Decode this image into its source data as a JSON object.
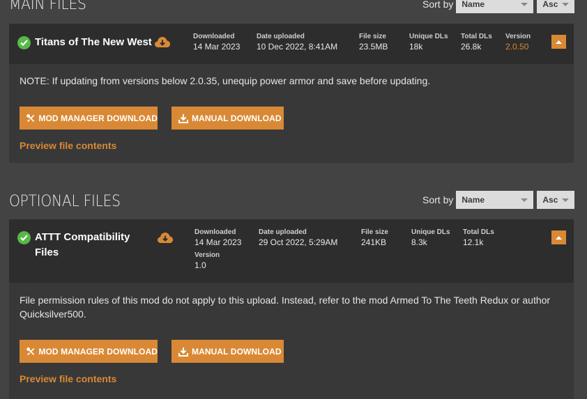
{
  "main_section": {
    "title": "MAIN FILES",
    "sort_label": "Sort by",
    "sort_field": "Name",
    "sort_order": "Asc"
  },
  "main_file": {
    "name": "Titans of The New West",
    "stats": {
      "downloaded_label": "Downloaded",
      "downloaded": "14 Mar 2023",
      "uploaded_label": "Date uploaded",
      "uploaded": "10 Dec 2022, 8:41AM",
      "size_label": "File size",
      "size": "23.5MB",
      "unique_label": "Unique DLs",
      "unique": "18k",
      "total_label": "Total DLs",
      "total": "26.8k",
      "version_label": "Version",
      "version": "2.0.50"
    },
    "description": "NOTE: If updating from versions below 2.0.35, unequip power armor and save before updating.",
    "mod_manager_label": "MOD MANAGER DOWNLOAD",
    "manual_label": "MANUAL DOWNLOAD",
    "preview_label": "Preview file contents"
  },
  "optional_section": {
    "title": "OPTIONAL FILES",
    "sort_label": "Sort by",
    "sort_field": "Name",
    "sort_order": "Asc"
  },
  "optional_file": {
    "name_line1": "ATTT Compatibility",
    "name_line2": "Files",
    "stats": {
      "downloaded_label": "Downloaded",
      "downloaded": "14 Mar 2023",
      "uploaded_label": "Date uploaded",
      "uploaded": "29 Oct 2022, 5:29AM",
      "size_label": "File size",
      "size": "241KB",
      "unique_label": "Unique DLs",
      "unique": "8.3k",
      "total_label": "Total DLs",
      "total": "12.1k",
      "version_label": "Version",
      "version": "1.0"
    },
    "description": "File permission rules of this mod do not apply to this upload. Instead, refer to the mod Armed To The Teeth Redux or author Quicksilver500.",
    "mod_manager_label": "MOD MANAGER DOWNLOAD",
    "manual_label": "MANUAL DOWNLOAD",
    "preview_label": "Preview file contents"
  },
  "colors": {
    "accent": "#d98935",
    "check": "#57b848",
    "background": "#434343",
    "card": "#383838",
    "card_header": "#2d2d2d"
  },
  "icons": [
    "check-circle-icon",
    "cloud-download-icon",
    "mod-manager-icon",
    "download-tray-icon",
    "chevron-up-icon",
    "caret-down-icon"
  ]
}
